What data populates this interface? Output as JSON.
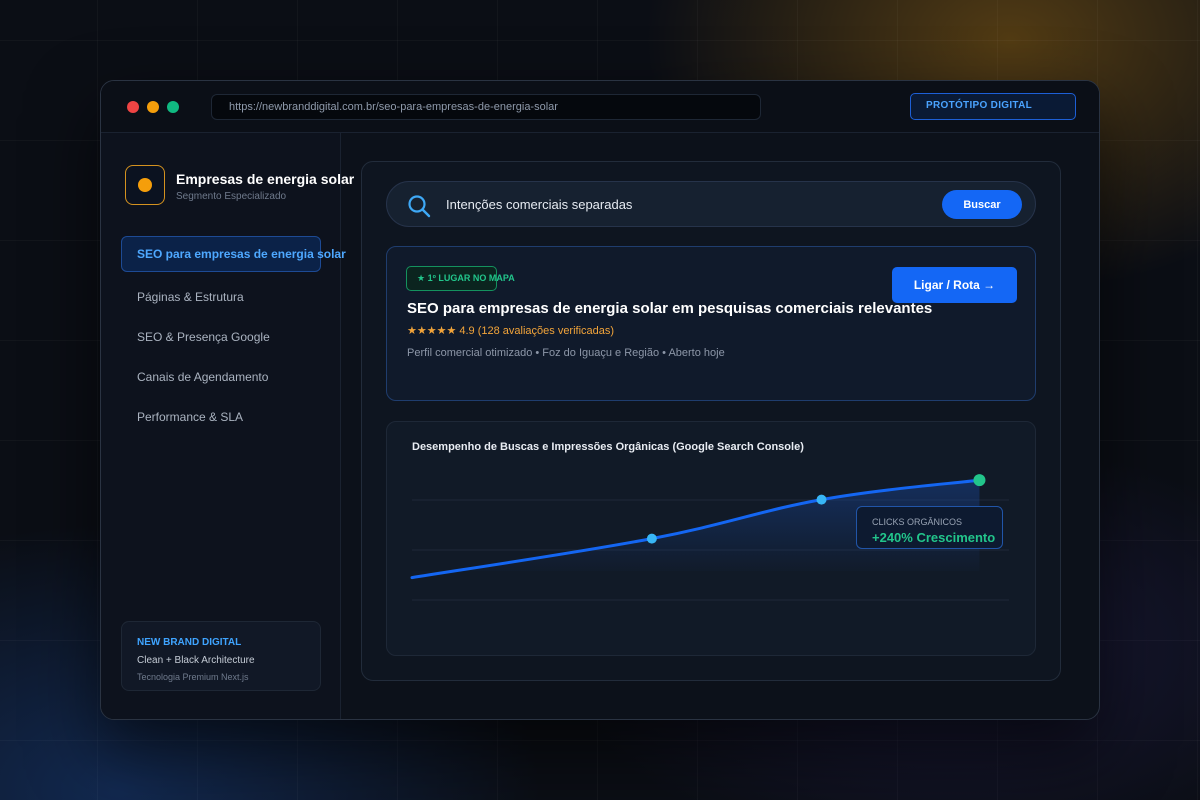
{
  "browser": {
    "url": "https://newbranddigital.com.br/seo-para-empresas-de-energia-solar",
    "badge": "PROTÓTIPO DIGITAL"
  },
  "sidebar": {
    "brand_title": "Empresas de energia solar",
    "brand_subtitle": "Segmento Especializado",
    "items": [
      {
        "label": "SEO para empresas de energia solar",
        "active": true
      },
      {
        "label": "Páginas & Estrutura",
        "active": false
      },
      {
        "label": "SEO & Presença Google",
        "active": false
      },
      {
        "label": "Canais de Agendamento",
        "active": false
      },
      {
        "label": "Performance & SLA",
        "active": false
      }
    ],
    "footer": {
      "title": "NEW BRAND DIGITAL",
      "line1": "Clean + Black Architecture",
      "line2": "Tecnologia Premium Next.js"
    }
  },
  "search": {
    "value": "Intenções comerciais separadas",
    "button_label": "Buscar"
  },
  "listing": {
    "badge": "★ 1º LUGAR NO MAPA",
    "action_label": "Ligar / Rota →",
    "title": "SEO para empresas de energia solar em pesquisas comerciais relevantes",
    "rating": "★★★★★ 4.9 (128 avaliações verificadas)",
    "meta": "Perfil comercial otimizado • Foz do Iguaçu e Região • Aberto hoje"
  },
  "chart": {
    "title": "Desempenho de Buscas e Impressões Orgânicas (Google Search Console)",
    "callout_label": "CLICKS ORGÂNICOS",
    "callout_value": "+240% Crescimento"
  },
  "chart_data": {
    "type": "line",
    "title": "Desempenho de Buscas e Impressões Orgânicas (Google Search Console)",
    "xlabel": "",
    "ylabel": "",
    "grid": true,
    "ylim": [
      0,
      100
    ],
    "series": [
      {
        "x": [
          0,
          0.41,
          0.7,
          0.97
        ],
        "values": [
          18,
          48,
          78,
          93
        ],
        "markers": [
          false,
          true,
          true,
          true
        ]
      }
    ],
    "colors": {
      "line": "#1466f2",
      "marker": "#38b6f5",
      "end_marker": "#22c58b"
    }
  },
  "colors": {
    "accent": "#1467f5",
    "success": "#22c58b",
    "warning": "#f59e0b",
    "rating": "#f2a43a"
  }
}
